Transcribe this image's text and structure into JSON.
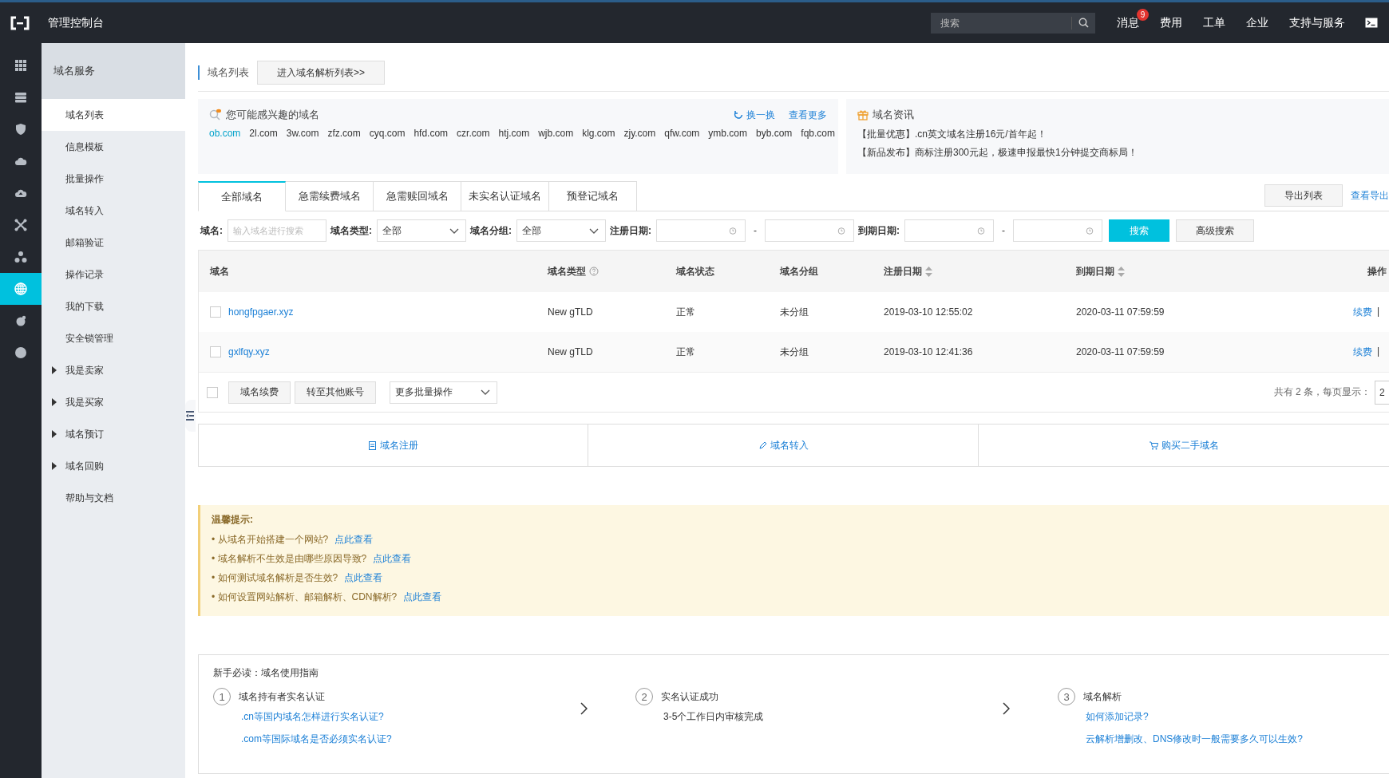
{
  "topbar": {
    "title": "管理控制台",
    "search": {
      "placeholder": "搜索"
    },
    "nav": [
      {
        "label": "消息",
        "badge": "9"
      },
      {
        "label": "费用"
      },
      {
        "label": "工单"
      },
      {
        "label": "企业"
      },
      {
        "label": "支持与服务"
      }
    ]
  },
  "rail": [
    {
      "selected": false
    },
    {
      "selected": false
    },
    {
      "selected": false
    },
    {
      "selected": false
    },
    {
      "selected": false
    },
    {
      "selected": false
    },
    {
      "selected": false
    },
    {
      "selected": true
    },
    {
      "selected": false
    },
    {
      "selected": false
    }
  ],
  "sidebar": {
    "title": "域名服务",
    "items": [
      {
        "label": "域名列表",
        "kind": "link",
        "selected": true
      },
      {
        "label": "信息模板",
        "kind": "link",
        "selected": false
      },
      {
        "label": "批量操作",
        "kind": "link",
        "selected": false
      },
      {
        "label": "域名转入",
        "kind": "link",
        "selected": false
      },
      {
        "label": "邮箱验证",
        "kind": "link",
        "selected": false
      },
      {
        "label": "操作记录",
        "kind": "link",
        "selected": false
      },
      {
        "label": "我的下载",
        "kind": "link",
        "selected": false
      },
      {
        "label": "安全锁管理",
        "kind": "link",
        "selected": false
      },
      {
        "label": "我是卖家",
        "kind": "group",
        "selected": false
      },
      {
        "label": "我是买家",
        "kind": "group",
        "selected": false
      },
      {
        "label": "域名预订",
        "kind": "group",
        "selected": false
      },
      {
        "label": "域名回购",
        "kind": "group",
        "selected": false
      },
      {
        "label": "帮助与文档",
        "kind": "link",
        "selected": false
      }
    ]
  },
  "breadcrumb": {
    "title": "域名列表",
    "button": "进入域名解析列表>>"
  },
  "suggest": {
    "title": "您可能感兴趣的域名",
    "refresh": "换一换",
    "more": "查看更多",
    "domains": [
      {
        "label": "ob.com",
        "selected": true
      },
      {
        "label": "2l.com",
        "selected": false
      },
      {
        "label": "3w.com",
        "selected": false
      },
      {
        "label": "zfz.com",
        "selected": false
      },
      {
        "label": "cyq.com",
        "selected": false
      },
      {
        "label": "hfd.com",
        "selected": false
      },
      {
        "label": "czr.com",
        "selected": false
      },
      {
        "label": "htj.com",
        "selected": false
      },
      {
        "label": "wjb.com",
        "selected": false
      },
      {
        "label": "klg.com",
        "selected": false
      },
      {
        "label": "zjy.com",
        "selected": false
      },
      {
        "label": "qfw.com",
        "selected": false
      },
      {
        "label": "ymb.com",
        "selected": false
      },
      {
        "label": "byb.com",
        "selected": false
      },
      {
        "label": "fqb.com",
        "selected": false
      }
    ]
  },
  "news": {
    "title": "域名资讯",
    "lines": [
      "【批量优惠】.cn英文域名注册16元/首年起！",
      "【新品发布】商标注册300元起，极速申报最快1分钟提交商标局！"
    ]
  },
  "tabs": [
    {
      "label": "全部域名",
      "selected": true
    },
    {
      "label": "急需续费域名",
      "selected": false
    },
    {
      "label": "急需赎回域名",
      "selected": false
    },
    {
      "label": "未实名认证域名",
      "selected": false
    },
    {
      "label": "预登记域名",
      "selected": false
    }
  ],
  "export": {
    "button": "导出列表",
    "link": "查看导出"
  },
  "filters": {
    "domain_label": "域名:",
    "domain_placeholder": "输入域名进行搜索",
    "type_label": "域名类型:",
    "type_value": "全部",
    "group_label": "域名分组:",
    "group_value": "全部",
    "reg_label": "注册日期:",
    "exp_label": "到期日期:",
    "dash": "-",
    "search": "搜索",
    "advanced": "高级搜索"
  },
  "table": {
    "columns": [
      {
        "label": "域名",
        "help": false,
        "sortable": false
      },
      {
        "label": "域名类型",
        "help": true,
        "sortable": false
      },
      {
        "label": "域名状态",
        "help": false,
        "sortable": false
      },
      {
        "label": "域名分组",
        "help": false,
        "sortable": false
      },
      {
        "label": "注册日期",
        "help": false,
        "sortable": true
      },
      {
        "label": "到期日期",
        "help": false,
        "sortable": true
      },
      {
        "label": "操作",
        "help": false,
        "sortable": false
      }
    ],
    "rows": [
      {
        "checked": false,
        "domain": "hongfpgaer.xyz",
        "type": "New gTLD",
        "status": "正常",
        "group": "未分组",
        "registered": "2019-03-10 12:55:02",
        "expires": "2020-03-11 07:59:59",
        "action": "续费",
        "sep": "|"
      },
      {
        "checked": false,
        "domain": "gxlfqy.xyz",
        "type": "New gTLD",
        "status": "正常",
        "group": "未分组",
        "registered": "2019-03-10 12:41:36",
        "expires": "2020-03-11 07:59:59",
        "action": "续费",
        "sep": "|"
      }
    ],
    "footer": {
      "checked": false,
      "renew": "域名续费",
      "transfer": "转至其他账号",
      "more": "更多批量操作",
      "total": "共有 2 条，每页显示：",
      "page_size": "2"
    }
  },
  "actions": [
    {
      "label": "域名注册"
    },
    {
      "label": "域名转入"
    },
    {
      "label": "购买二手域名"
    }
  ],
  "tips": {
    "title": "温馨提示:",
    "items": [
      {
        "text": "• 从域名开始搭建一个网站?",
        "link": "点此查看"
      },
      {
        "text": "• 域名解析不生效是由哪些原因导致?",
        "link": "点此查看"
      },
      {
        "text": "• 如何测试域名解析是否生效?",
        "link": "点此查看"
      },
      {
        "text": "• 如何设置网站解析、邮箱解析、CDN解析?",
        "link": "点此查看"
      }
    ]
  },
  "guide": {
    "title": "新手必读：域名使用指南",
    "steps": [
      {
        "number": "1",
        "title": "域名持有者实名认证",
        "lines": [
          {
            "text": ".cn等国内域名怎样进行实名认证?",
            "link": true
          },
          {
            "text": ".com等国际域名是否必须实名认证?",
            "link": true
          }
        ]
      },
      {
        "number": "2",
        "title": "实名认证成功",
        "lines": [
          {
            "text": "3-5个工作日内审核完成",
            "link": false
          }
        ]
      },
      {
        "number": "3",
        "title": "域名解析",
        "lines": [
          {
            "text": "如何添加记录?",
            "link": true
          },
          {
            "text": "云解析增删改、DNS修改时一般需要多久可以生效?",
            "link": true
          }
        ]
      }
    ]
  }
}
